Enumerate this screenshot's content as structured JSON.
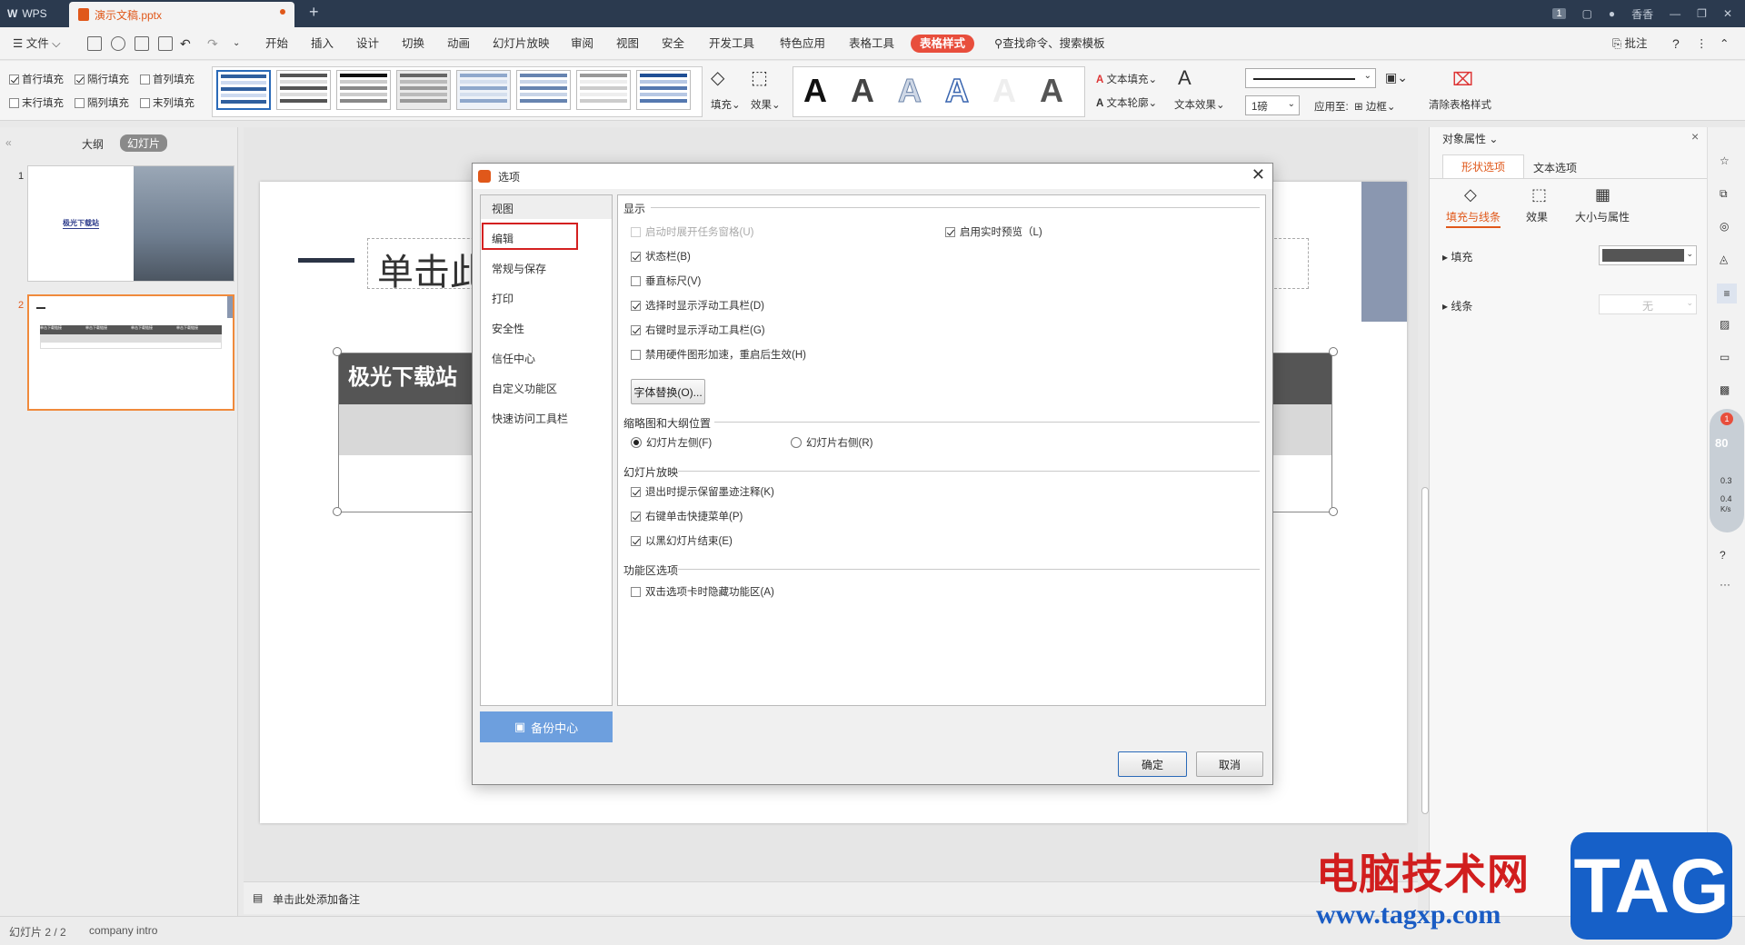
{
  "titlebar": {
    "app": "WPS",
    "doc_tab": "演示文稿.pptx",
    "new_tab": "+",
    "badge": "1",
    "user": "香香"
  },
  "menu": {
    "file": "文件",
    "items": [
      "开始",
      "插入",
      "设计",
      "切换",
      "动画",
      "幻灯片放映",
      "审阅",
      "视图",
      "安全",
      "开发工具",
      "特色应用",
      "表格工具"
    ],
    "active": "表格样式",
    "search": "查找命令、搜索模板",
    "comment": "批注",
    "help": "?"
  },
  "ribbon": {
    "checks": [
      {
        "label": "首行填充",
        "checked": true
      },
      {
        "label": "隔行填充",
        "checked": true
      },
      {
        "label": "首列填充",
        "checked": false
      },
      {
        "label": "末行填充",
        "checked": false
      },
      {
        "label": "隔列填充",
        "checked": false
      },
      {
        "label": "末列填充",
        "checked": false
      }
    ],
    "fill": "填充",
    "effect": "效果",
    "text_fill": "文本填充",
    "text_outline": "文本轮廓",
    "text_effect": "文本效果",
    "line_weight": "1磅",
    "apply_to": "应用至:",
    "border": "边框",
    "clear_style": "清除表格样式"
  },
  "leftpanel": {
    "tab_outline": "大纲",
    "tab_slides": "幻灯片",
    "slide1_num": "1",
    "slide1_title": "极光下载站",
    "slide2_num": "2",
    "slide2_cells": [
      "单击下载链接",
      "单击下载链接",
      "单击下载链接",
      "单击下载链接"
    ]
  },
  "slide": {
    "title_placeholder": "单击此",
    "table_header": "极光下载站"
  },
  "notes": {
    "placeholder": "单击此处添加备注"
  },
  "status": {
    "slide": "幻灯片 2 / 2",
    "theme": "company intro"
  },
  "rightpanel": {
    "title": "对象属性",
    "tab_shape": "形状选项",
    "tab_text": "文本选项",
    "sub_fill": "填充与线条",
    "sub_effect": "效果",
    "sub_size": "大小与属性",
    "fill_label": "填充",
    "line_label": "线条",
    "line_value": "无"
  },
  "floatwidget": {
    "notif": "1",
    "percent": "80",
    "up": "0.3",
    "down": "0.4",
    "unit": "K/s"
  },
  "dialog": {
    "title": "选项",
    "nav": [
      "视图",
      "编辑",
      "常规与保存",
      "打印",
      "安全性",
      "信任中心",
      "自定义功能区",
      "快速访问工具栏"
    ],
    "sections": {
      "display": "显示",
      "thumb_pos": "缩略图和大纲位置",
      "slideshow": "幻灯片放映",
      "ribbon": "功能区选项"
    },
    "display_opts": [
      {
        "label": "启动时展开任务窗格(U)",
        "checked": false,
        "disabled": true
      },
      {
        "label": "状态栏(B)",
        "checked": true
      },
      {
        "label": "垂直标尺(V)",
        "checked": false
      },
      {
        "label": "选择时显示浮动工具栏(D)",
        "checked": true
      },
      {
        "label": "右键时显示浮动工具栏(G)",
        "checked": true
      },
      {
        "label": "禁用硬件图形加速，重启后生效(H)",
        "checked": false
      }
    ],
    "realtime_preview": {
      "label": "启用实时预览（L)",
      "checked": true
    },
    "font_replace": "字体替换(O)...",
    "thumb_left": "幻灯片左侧(F)",
    "thumb_right": "幻灯片右侧(R)",
    "slideshow_opts": [
      {
        "label": "退出时提示保留墨迹注释(K)",
        "checked": true
      },
      {
        "label": "右键单击快捷菜单(P)",
        "checked": true
      },
      {
        "label": "以黑幻灯片结束(E)",
        "checked": true
      }
    ],
    "ribbon_opt": {
      "label": "双击选项卡时隐藏功能区(A)",
      "checked": false
    },
    "backup": "备份中心",
    "ok": "确定",
    "cancel": "取消"
  },
  "watermark": {
    "text": "电脑技术网",
    "url": "www.tagxp.com",
    "tag": "TAG"
  }
}
